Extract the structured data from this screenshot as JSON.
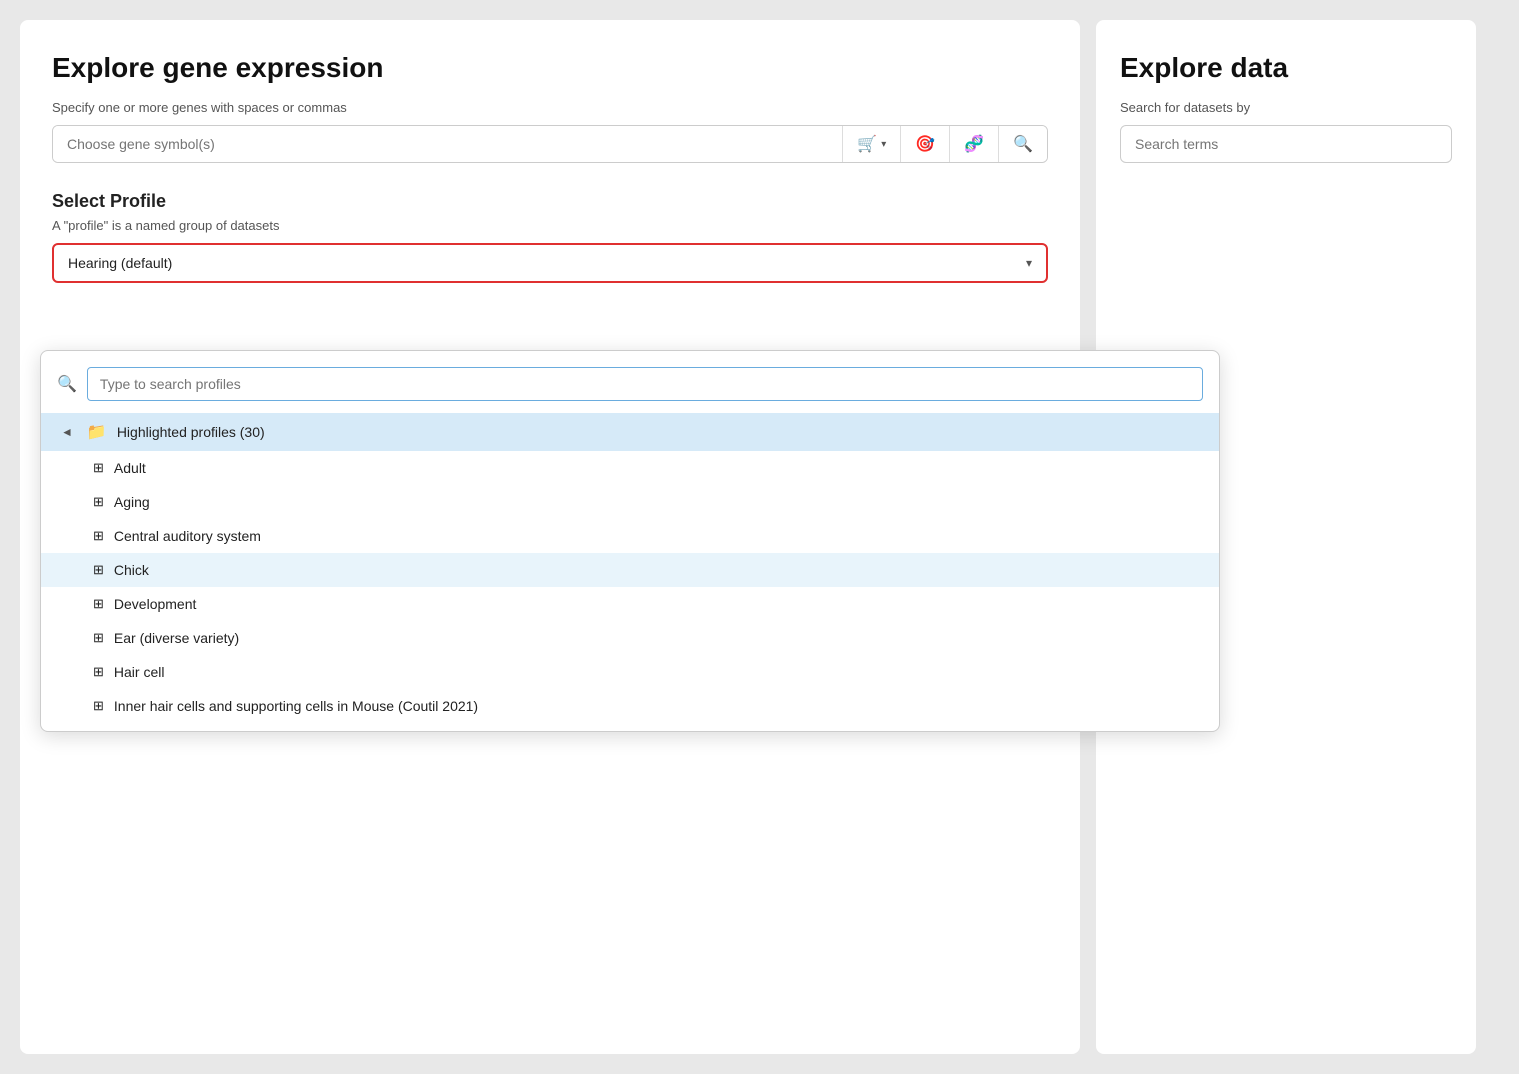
{
  "left_panel": {
    "title": "Explore gene expression",
    "gene_subtitle": "Specify one or more genes with spaces or commas",
    "gene_placeholder": "Choose gene symbol(s)",
    "gene_buttons": [
      {
        "label": "🛒",
        "extra": "▾",
        "name": "cart-button"
      },
      {
        "label": "🎯",
        "name": "target-button"
      },
      {
        "label": "🧬",
        "name": "dna-button"
      },
      {
        "label": "🔍",
        "name": "search-gene-button"
      }
    ],
    "select_profile_title": "Select Profile",
    "select_profile_desc": "A \"profile\" is a named group of datasets",
    "profile_current": "Hearing (default)",
    "dropdown": {
      "search_placeholder": "Type to search profiles",
      "items": [
        {
          "type": "group",
          "label": "Highlighted profiles (30)",
          "collapsed": false,
          "indent": 0
        },
        {
          "type": "item",
          "label": "Adult",
          "indent": 1
        },
        {
          "type": "item",
          "label": "Aging",
          "indent": 1
        },
        {
          "type": "item",
          "label": "Central auditory system",
          "indent": 1
        },
        {
          "type": "item",
          "label": "Chick",
          "indent": 1,
          "selected": true
        },
        {
          "type": "item",
          "label": "Development",
          "indent": 1
        },
        {
          "type": "item",
          "label": "Ear (diverse variety)",
          "indent": 1
        },
        {
          "type": "item",
          "label": "Hair cell",
          "indent": 1
        },
        {
          "type": "item",
          "label": "Inner hair cells and supporting cells in Mouse (Coutil 2021)",
          "indent": 1
        }
      ]
    }
  },
  "right_panel": {
    "title": "Explore data",
    "subtitle": "Search for datasets by",
    "search_placeholder": "Search terms"
  }
}
